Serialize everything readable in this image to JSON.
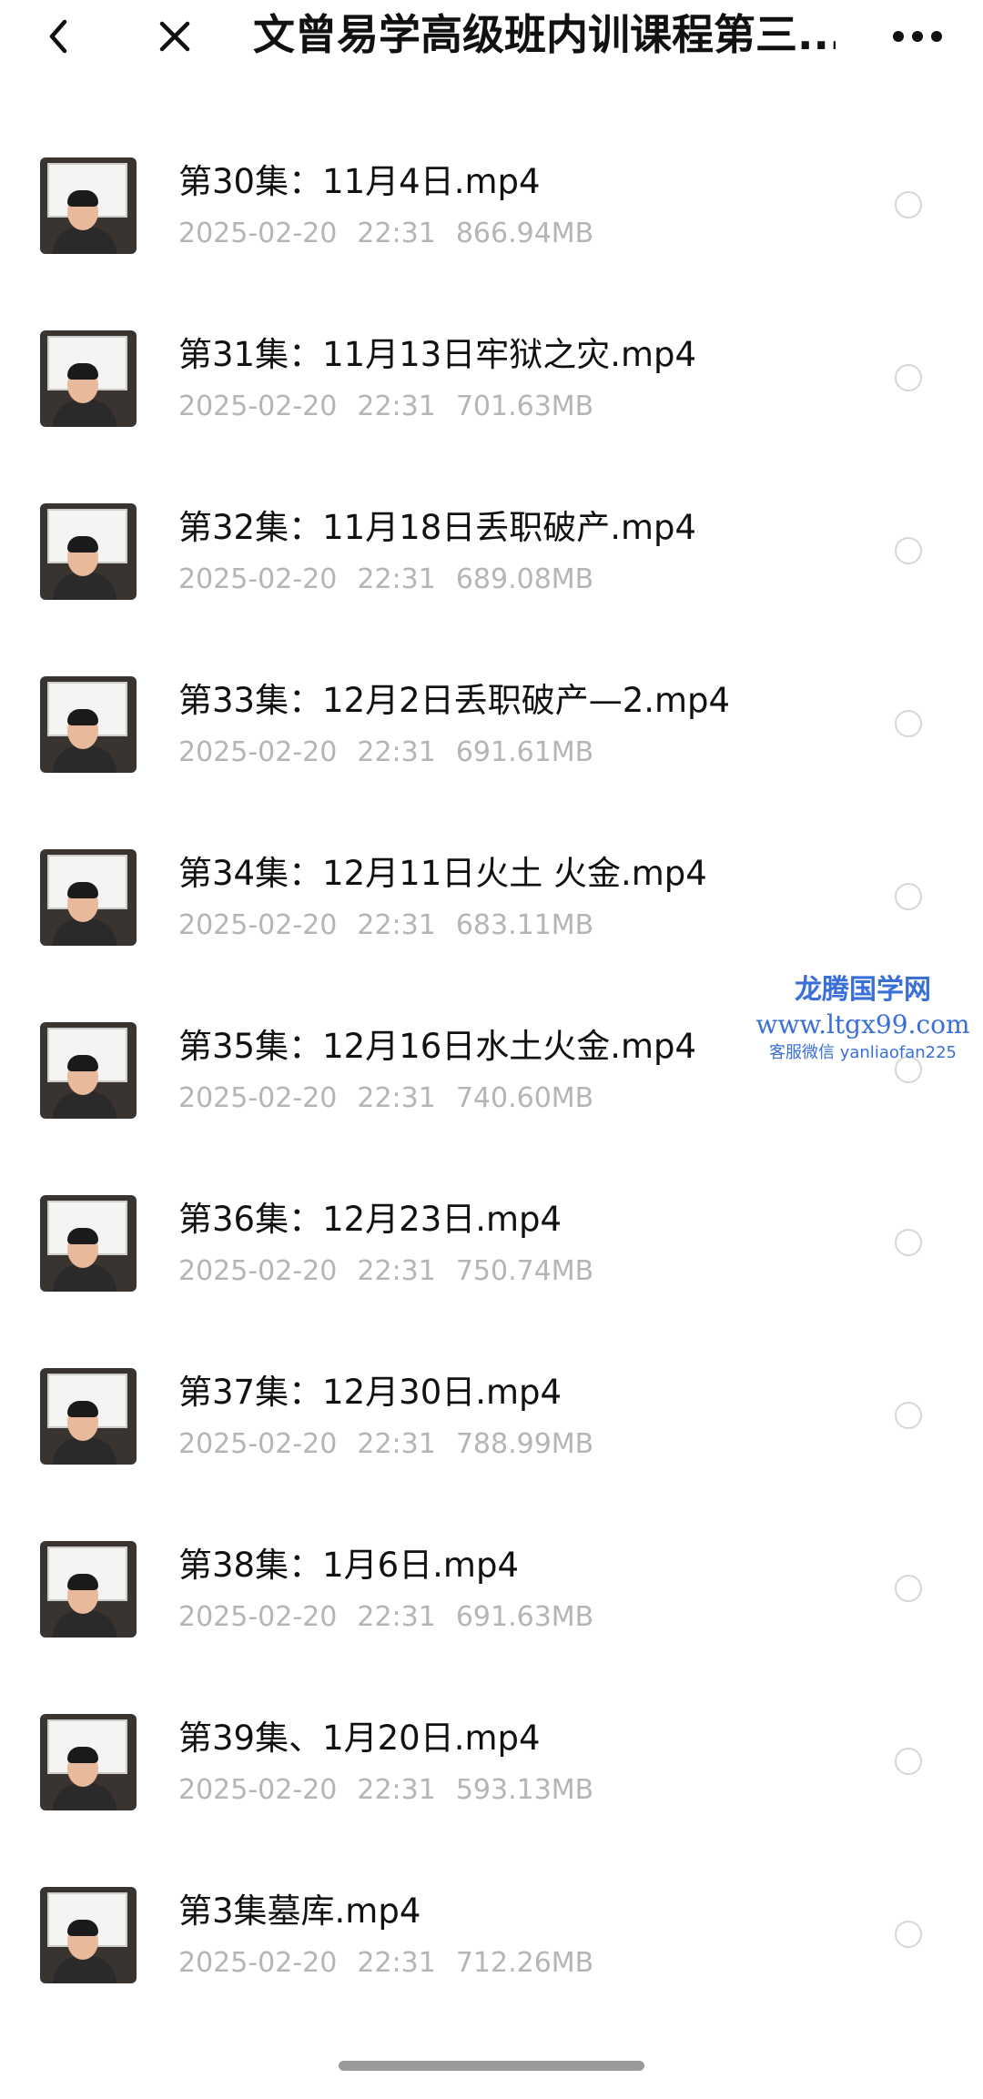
{
  "header": {
    "back_icon": "chevron-left-icon",
    "close_icon": "close-icon",
    "more_icon": "more-horizontal-icon",
    "title": "文曾易学高级班内训课程第三..."
  },
  "files": [
    {
      "name": "第30集：11月4日.mp4",
      "date": "2025-02-20",
      "time": "22:31",
      "size": "866.94MB"
    },
    {
      "name": "第31集：11月13日牢狱之灾.mp4",
      "date": "2025-02-20",
      "time": "22:31",
      "size": "701.63MB"
    },
    {
      "name": "第32集：11月18日丢职破产.mp4",
      "date": "2025-02-20",
      "time": "22:31",
      "size": "689.08MB"
    },
    {
      "name": "第33集：12月2日丢职破产—2.mp4",
      "date": "2025-02-20",
      "time": "22:31",
      "size": "691.61MB"
    },
    {
      "name": "第34集：12月11日火土 火金.mp4",
      "date": "2025-02-20",
      "time": "22:31",
      "size": "683.11MB"
    },
    {
      "name": "第35集：12月16日水土火金.mp4",
      "date": "2025-02-20",
      "time": "22:31",
      "size": "740.60MB"
    },
    {
      "name": "第36集：12月23日.mp4",
      "date": "2025-02-20",
      "time": "22:31",
      "size": "750.74MB"
    },
    {
      "name": "第37集：12月30日.mp4",
      "date": "2025-02-20",
      "time": "22:31",
      "size": "788.99MB"
    },
    {
      "name": "第38集：1月6日.mp4",
      "date": "2025-02-20",
      "time": "22:31",
      "size": "691.63MB"
    },
    {
      "name": "第39集、1月20日.mp4",
      "date": "2025-02-20",
      "time": "22:31",
      "size": "593.13MB"
    },
    {
      "name": "第3集墓库.mp4",
      "date": "2025-02-20",
      "time": "22:31",
      "size": "712.26MB"
    }
  ],
  "watermark": {
    "line1": "龙腾国学网",
    "line2": "www.ltgx99.com",
    "line3": "客服微信 yanliaofan225"
  },
  "colors": {
    "meta_text": "#b5b5b5",
    "radio_border": "#d6d6d6",
    "watermark": "#3a6fd8"
  }
}
